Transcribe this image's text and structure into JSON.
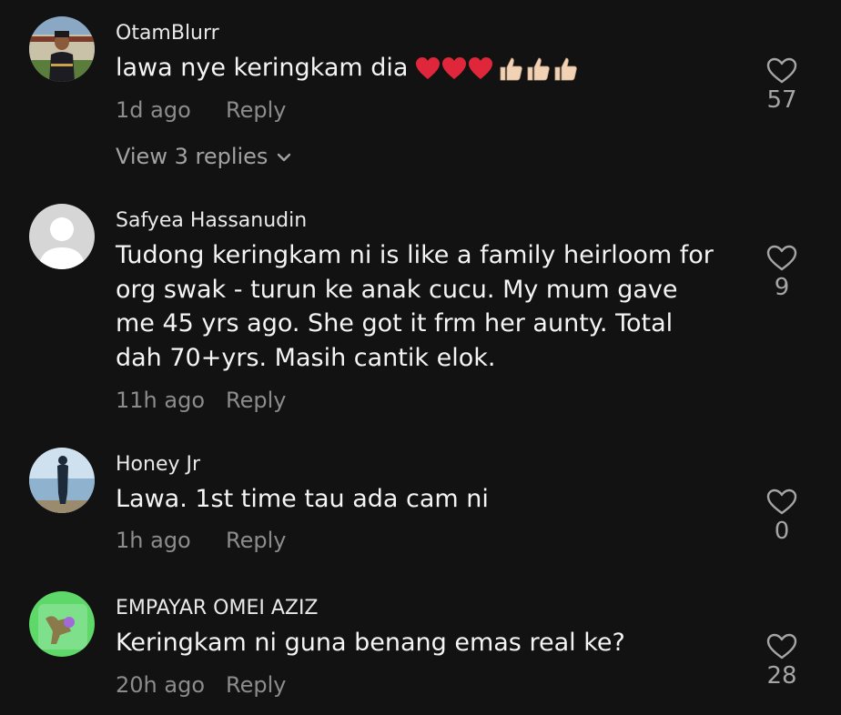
{
  "comments": [
    {
      "username": "OtamBlurr",
      "text": "lawa nye keringkam dia",
      "emojis": "heart-heart-heart-thumbsup-thumbsup-thumbsup",
      "time": "1d ago",
      "reply_label": "Reply",
      "likes": "57",
      "view_replies_label": "View 3 replies"
    },
    {
      "username": "Safyea Hassanudin",
      "text": "Tudong keringkam ni is like a family heirloom for org swak - turun ke anak cucu. My mum gave me 45 yrs ago. She got it frm her aunty. Total dah 70+yrs. Masih cantik elok.",
      "time": "11h ago",
      "reply_label": "Reply",
      "likes": "9"
    },
    {
      "username": "Honey Jr",
      "text": "Lawa. 1st time tau ada cam ni",
      "time": "1h ago",
      "reply_label": "Reply",
      "likes": "0"
    },
    {
      "username": "EMPAYAR OMEI AZIZ",
      "text": "Keringkam ni guna benang emas real ke?",
      "time": "20h ago",
      "reply_label": "Reply",
      "likes": "28"
    }
  ],
  "colors": {
    "background": "#121212",
    "username": "#e9e9e9",
    "text": "#f4f4f4",
    "meta": "#8c8c8c",
    "heart_red": "#e0263a",
    "thumb_skin": "#f1d2b4"
  },
  "icons": {
    "like": "heart-outline-icon",
    "expand": "chevron-down-icon"
  }
}
